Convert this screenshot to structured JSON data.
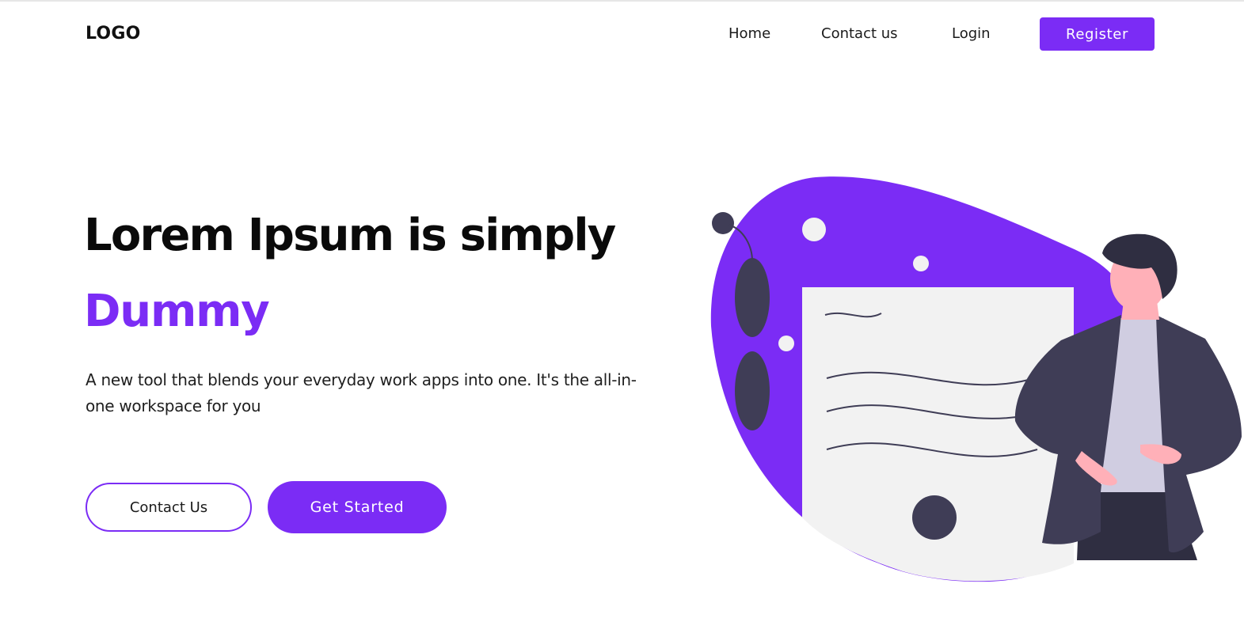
{
  "header": {
    "logo": "LOGO",
    "nav": [
      {
        "label": "Home"
      },
      {
        "label": "Contact us"
      },
      {
        "label": "Login"
      }
    ],
    "register_label": "Register"
  },
  "hero": {
    "title": "Lorem Ipsum is simply",
    "accent": "Dummy",
    "description": "A new tool that blends your everyday work apps into one. It's the all-in-one workspace for you",
    "contact_label": "Contact Us",
    "get_started_label": "Get Started"
  },
  "colors": {
    "accent": "#7b2cf5",
    "text": "#0a0a0a",
    "illustration_dark": "#3f3d56",
    "illustration_light": "#f2f2f2",
    "skin": "#ffb0b8"
  },
  "illustration": {
    "icon": "person-presenting-board-illustration"
  }
}
